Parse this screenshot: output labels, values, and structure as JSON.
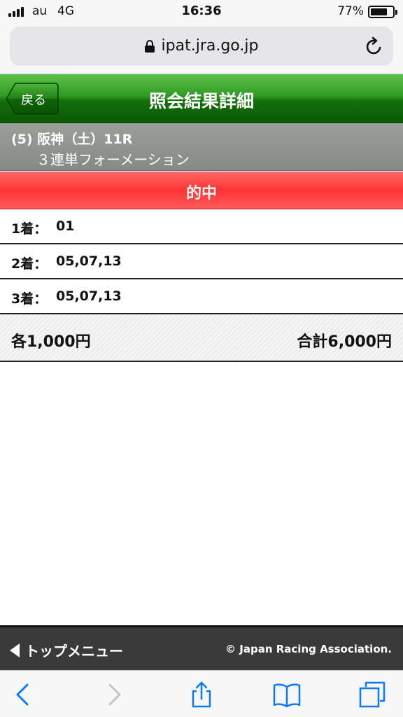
{
  "status_bar": {
    "carrier": "au",
    "network": "4G",
    "time": "16:36",
    "battery_percent": "77%",
    "battery_level": 0.77
  },
  "browser": {
    "url": "ipat.jra.go.jp"
  },
  "header": {
    "back_label": "戻る",
    "title": "照会結果詳細"
  },
  "race": {
    "line1": "(5) 阪神（土）11R",
    "bet_type": "３連単フォーメーション"
  },
  "result": {
    "status": "的中"
  },
  "places": [
    {
      "label": "1着：",
      "value": "01"
    },
    {
      "label": "2着：",
      "value": "05,07,13"
    },
    {
      "label": "3着：",
      "value": "05,07,13"
    }
  ],
  "amounts": {
    "unit": "各1,000円",
    "total": "合計6,000円"
  },
  "footer": {
    "top_menu_label": "トップメニュー",
    "copyright": "© Japan Racing Association."
  },
  "colors": {
    "header_green": "#146f0a",
    "race_gray": "#8e928e",
    "hit_red": "#ff3434",
    "footer_dark": "#3a3a3a",
    "ios_blue": "#0a7aff"
  },
  "icons": {
    "signal": "cellular-signal-icon",
    "battery": "battery-icon",
    "lock": "lock-icon",
    "reload": "reload-icon",
    "back": "back-arrow-icon",
    "forward": "forward-arrow-icon",
    "share": "share-icon",
    "bookmarks": "bookmarks-icon",
    "tabs": "tabs-icon"
  }
}
